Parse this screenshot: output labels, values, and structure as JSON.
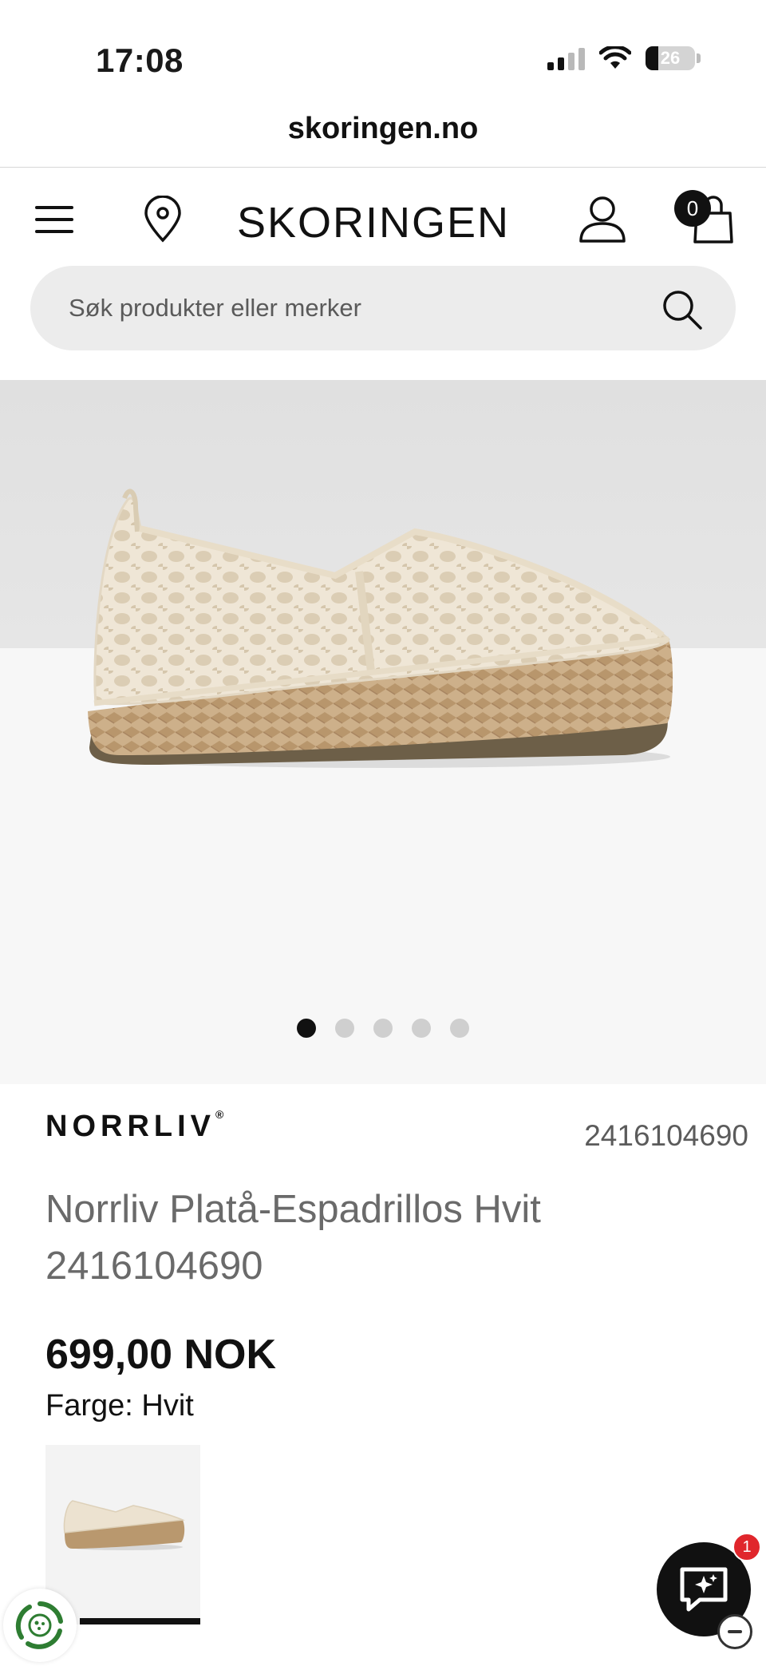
{
  "status_bar": {
    "time": "17:08",
    "battery": "26"
  },
  "browser": {
    "url": "skoringen.no"
  },
  "header": {
    "logo": "SKORINGEN",
    "cart_count": "0"
  },
  "search": {
    "placeholder": "Søk produkter eller merker"
  },
  "gallery": {
    "image_count": 5,
    "active_index": 0
  },
  "product": {
    "brand": "NORRLIV",
    "brand_mark": "®",
    "article_number": "2416104690",
    "title": "Norrliv Platå-Espadrillos Hvit 2416104690",
    "price": "699,00 NOK",
    "color_label": "Farge: Hvit"
  },
  "chat": {
    "unread_count": "1"
  },
  "icons": [
    "menu-icon",
    "location-pin-icon",
    "user-icon",
    "shopping-bag-icon",
    "search-icon",
    "recycle-icon",
    "chat-sparkle-icon",
    "minimize-icon"
  ]
}
